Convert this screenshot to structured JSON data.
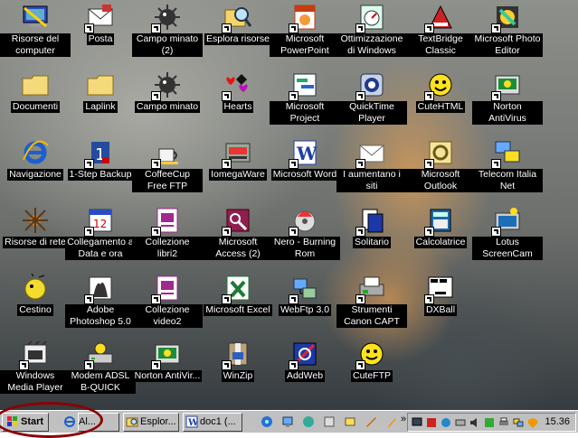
{
  "desktop": {
    "icons": [
      {
        "label": "Risorse del computer",
        "icon": "computer-icon",
        "shortcut": false
      },
      {
        "label": "Posta",
        "icon": "mail-icon",
        "shortcut": true
      },
      {
        "label": "Campo minato (2)",
        "icon": "mine-icon",
        "shortcut": true
      },
      {
        "label": "Esplora risorse",
        "icon": "explorer-icon",
        "shortcut": true
      },
      {
        "label": "Microsoft PowerPoint",
        "icon": "powerpoint-icon",
        "shortcut": true
      },
      {
        "label": "Ottimizzazione di Windows",
        "icon": "tuneup-icon",
        "shortcut": true
      },
      {
        "label": "TextBridge Classic",
        "icon": "textbridge-icon",
        "shortcut": true
      },
      {
        "label": "Microsoft Photo Editor",
        "icon": "photo-editor-icon",
        "shortcut": true
      },
      {
        "label": "Documenti",
        "icon": "folder-icon",
        "shortcut": false
      },
      {
        "label": "Laplink",
        "icon": "folder-icon",
        "shortcut": false
      },
      {
        "label": "Campo minato",
        "icon": "mine-icon",
        "shortcut": true
      },
      {
        "label": "Hearts",
        "icon": "hearts-icon",
        "shortcut": true
      },
      {
        "label": "Microsoft Project",
        "icon": "project-icon",
        "shortcut": true
      },
      {
        "label": "QuickTime Player",
        "icon": "quicktime-icon",
        "shortcut": true
      },
      {
        "label": "CuteHTML",
        "icon": "cutehtml-icon",
        "shortcut": true
      },
      {
        "label": "Norton AntiVirus",
        "icon": "norton-icon",
        "shortcut": true
      },
      {
        "label": "Navigazione",
        "icon": "ie-icon",
        "shortcut": false
      },
      {
        "label": "1-Step Backup",
        "icon": "backup-icon",
        "shortcut": true
      },
      {
        "label": "CoffeeCup Free FTP",
        "icon": "coffeecup-icon",
        "shortcut": true
      },
      {
        "label": "IomegaWare",
        "icon": "iomega-icon",
        "shortcut": true
      },
      {
        "label": "Microsoft Word",
        "icon": "word-icon",
        "shortcut": true
      },
      {
        "label": "I aumentano i siti",
        "icon": "envelope-icon",
        "shortcut": true
      },
      {
        "label": "Microsoft Outlook",
        "icon": "outlook-icon",
        "shortcut": true
      },
      {
        "label": "Telecom Italia Net",
        "icon": "network-icon",
        "shortcut": true
      },
      {
        "label": "Risorse di rete",
        "icon": "network-neighborhood-icon",
        "shortcut": false
      },
      {
        "label": "Collegamento a Data e ora",
        "icon": "calendar-icon",
        "shortcut": true
      },
      {
        "label": "Collezione libri2",
        "icon": "database-icon",
        "shortcut": true
      },
      {
        "label": "Microsoft Access (2)",
        "icon": "access-icon",
        "shortcut": true
      },
      {
        "label": "Nero - Burning Rom",
        "icon": "nero-icon",
        "shortcut": true
      },
      {
        "label": "Solitario",
        "icon": "solitaire-icon",
        "shortcut": true
      },
      {
        "label": "Calcolatrice",
        "icon": "calculator-icon",
        "shortcut": true
      },
      {
        "label": "Lotus ScreenCam",
        "icon": "screencam-icon",
        "shortcut": true
      },
      {
        "label": "Cestino",
        "icon": "recycle-bin-icon",
        "shortcut": false
      },
      {
        "label": "Adobe Photoshop 5.0",
        "icon": "photoshop-icon",
        "shortcut": true
      },
      {
        "label": "Collezione video2",
        "icon": "database-icon",
        "shortcut": true
      },
      {
        "label": "Microsoft Excel",
        "icon": "excel-icon",
        "shortcut": true
      },
      {
        "label": "WebFtp 3.0",
        "icon": "webftp-icon",
        "shortcut": true
      },
      {
        "label": "Strumenti Canon CAPT",
        "icon": "printer-tools-icon",
        "shortcut": true
      },
      {
        "label": "DXBall",
        "icon": "dxball-icon",
        "shortcut": true
      },
      {
        "label": "Windows Media Player",
        "icon": "media-player-icon",
        "shortcut": true
      },
      {
        "label": "Modem ADSL B-QUICK",
        "icon": "modem-icon",
        "shortcut": true
      },
      {
        "label": "Norton AntiVir...",
        "icon": "norton-icon",
        "shortcut": true
      },
      {
        "label": "WinZip",
        "icon": "winzip-icon",
        "shortcut": true
      },
      {
        "label": "AddWeb",
        "icon": "addweb-icon",
        "shortcut": true
      },
      {
        "label": "CuteFTP",
        "icon": "cuteftp-icon",
        "shortcut": true
      }
    ]
  },
  "taskbar": {
    "start_label": "Start",
    "tasks": [
      {
        "label": "Al...",
        "icon": "ie-icon"
      },
      {
        "label": "Esplor...",
        "icon": "explorer-icon"
      },
      {
        "label": "doc1 (...",
        "icon": "word-icon"
      }
    ],
    "clock": "15.36"
  }
}
